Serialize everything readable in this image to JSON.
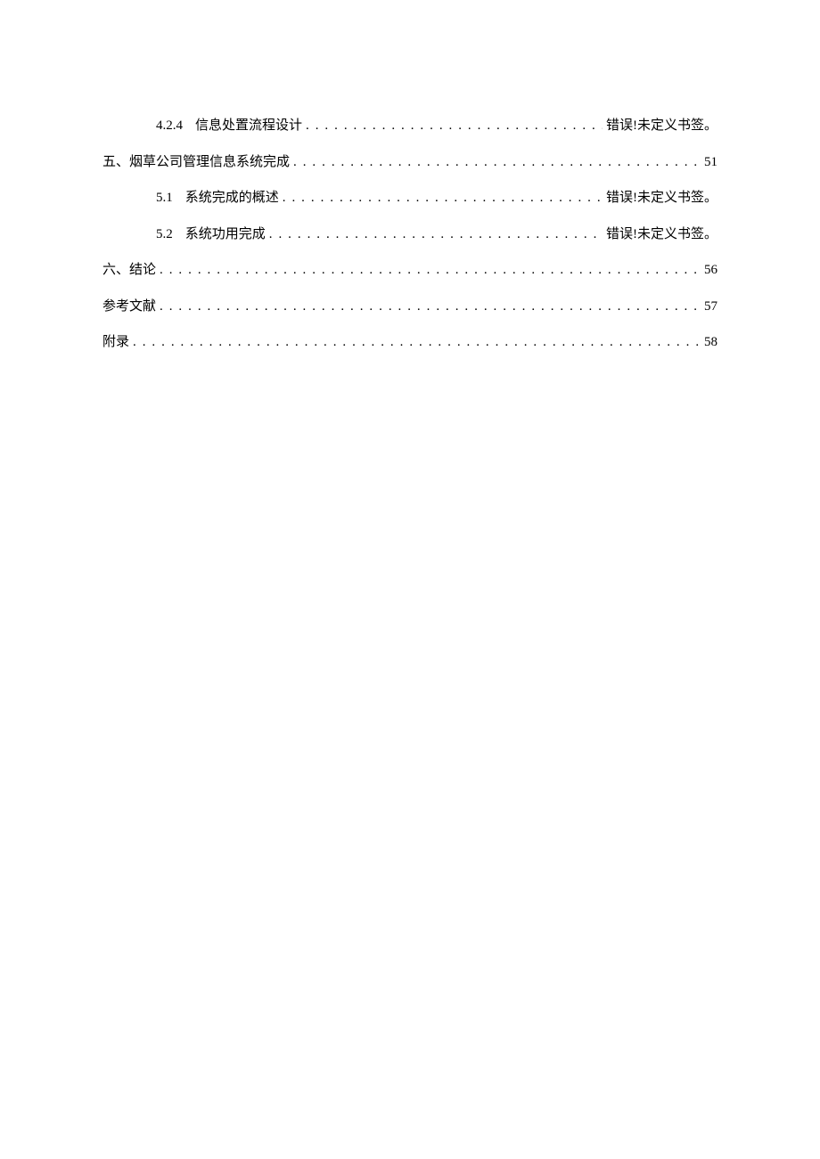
{
  "toc": [
    {
      "indent": 3,
      "num": "4.2.4",
      "title": "信息处置流程设计",
      "page": "错误!未定义书签。"
    },
    {
      "indent": 1,
      "num": "",
      "title": "五、烟草公司管理信息系统完成",
      "page": "51"
    },
    {
      "indent": 2,
      "num": "5.1",
      "title": "系统完成的概述",
      "page": "错误!未定义书签。"
    },
    {
      "indent": 2,
      "num": "5.2",
      "title": "系统功用完成",
      "page": "错误!未定义书签。"
    },
    {
      "indent": 1,
      "num": "",
      "title": "六、结论",
      "page": "56"
    },
    {
      "indent": 1,
      "num": "",
      "title": "参考文献",
      "page": "57"
    },
    {
      "indent": 1,
      "num": "",
      "title": "附录",
      "page": "58"
    }
  ]
}
